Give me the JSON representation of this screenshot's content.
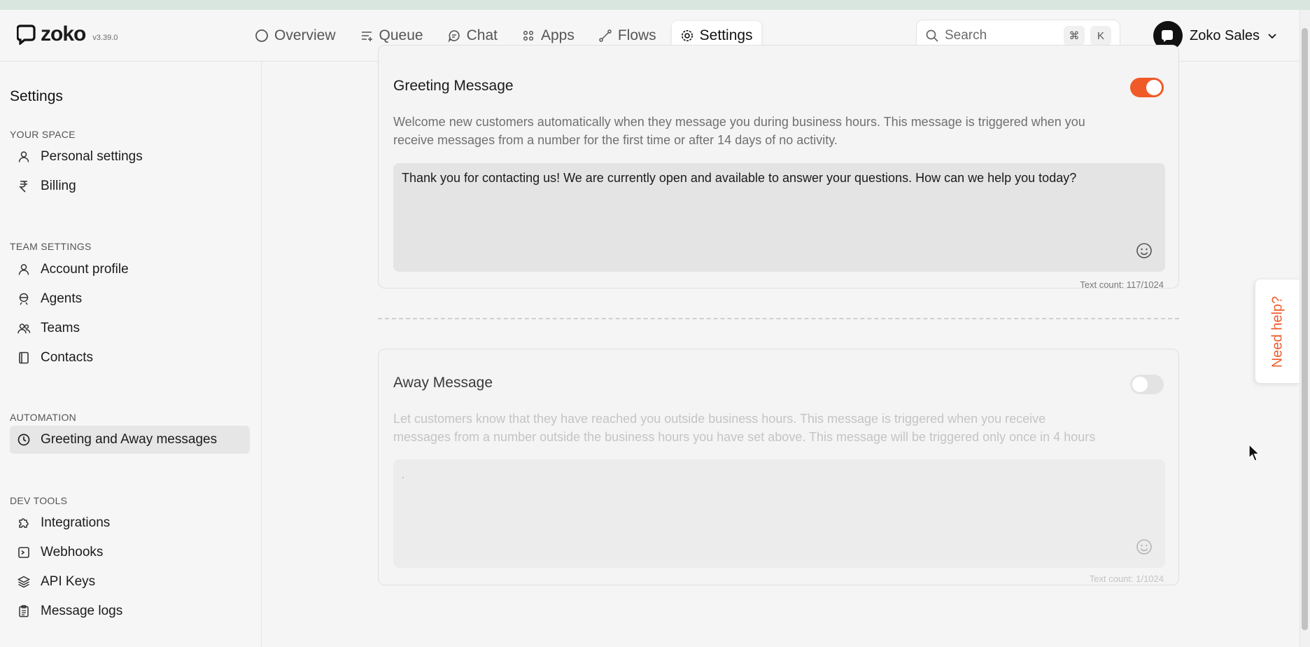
{
  "app": {
    "logo_text": "zoko",
    "version": "v3.39.0"
  },
  "nav": {
    "items": [
      {
        "label": "Overview",
        "icon": "circle-icon"
      },
      {
        "label": "Queue",
        "icon": "queue-icon"
      },
      {
        "label": "Chat",
        "icon": "chat-icon"
      },
      {
        "label": "Apps",
        "icon": "apps-grid-icon"
      },
      {
        "label": "Flows",
        "icon": "flows-icon"
      },
      {
        "label": "Settings",
        "icon": "gear-icon",
        "active": true
      }
    ]
  },
  "search": {
    "placeholder": "Search",
    "shortcut_cmd": "⌘",
    "shortcut_key": "K"
  },
  "account": {
    "name": "Zoko Sales"
  },
  "sidebar": {
    "title": "Settings",
    "sections": [
      {
        "label": "YOUR SPACE",
        "items": [
          {
            "label": "Personal settings",
            "icon": "person-icon"
          },
          {
            "label": "Billing",
            "icon": "rupee-icon"
          }
        ]
      },
      {
        "label": "TEAM SETTINGS",
        "items": [
          {
            "label": "Account profile",
            "icon": "person-icon"
          },
          {
            "label": "Agents",
            "icon": "agent-icon"
          },
          {
            "label": "Teams",
            "icon": "teams-icon"
          },
          {
            "label": "Contacts",
            "icon": "contacts-book-icon"
          }
        ]
      },
      {
        "label": "AUTOMATION",
        "items": [
          {
            "label": "Greeting and Away messages",
            "icon": "clock-icon",
            "active": true
          }
        ]
      },
      {
        "label": "DEV TOOLS",
        "items": [
          {
            "label": "Integrations",
            "icon": "puzzle-icon"
          },
          {
            "label": "Webhooks",
            "icon": "terminal-icon"
          },
          {
            "label": "API Keys",
            "icon": "layers-icon"
          },
          {
            "label": "Message logs",
            "icon": "clipboard-icon"
          }
        ]
      }
    ]
  },
  "greeting": {
    "title": "Greeting Message",
    "enabled": true,
    "description_line1": "Welcome new customers automatically when they message you during business hours. This message is triggered when you",
    "description_line2": "receive messages from a number for the first time or after 14 days of no activity.",
    "message": "Thank you for contacting us! We are currently open and available to answer your questions. How can we help you today?",
    "text_count": "Text count: 117/1024"
  },
  "away": {
    "title": "Away Message",
    "enabled": false,
    "description_line1": "Let customers know that they have reached you outside business hours. This message is triggered when you receive",
    "description_line2": "messages from a number outside the business hours you have set above. This message will be triggered only once in 4 hours",
    "message": ".",
    "text_count": "Text count: 1/1024"
  },
  "help": {
    "label": "Need help?"
  },
  "colors": {
    "accent": "#f05a29",
    "toggle_off": "#e3e3e3"
  }
}
